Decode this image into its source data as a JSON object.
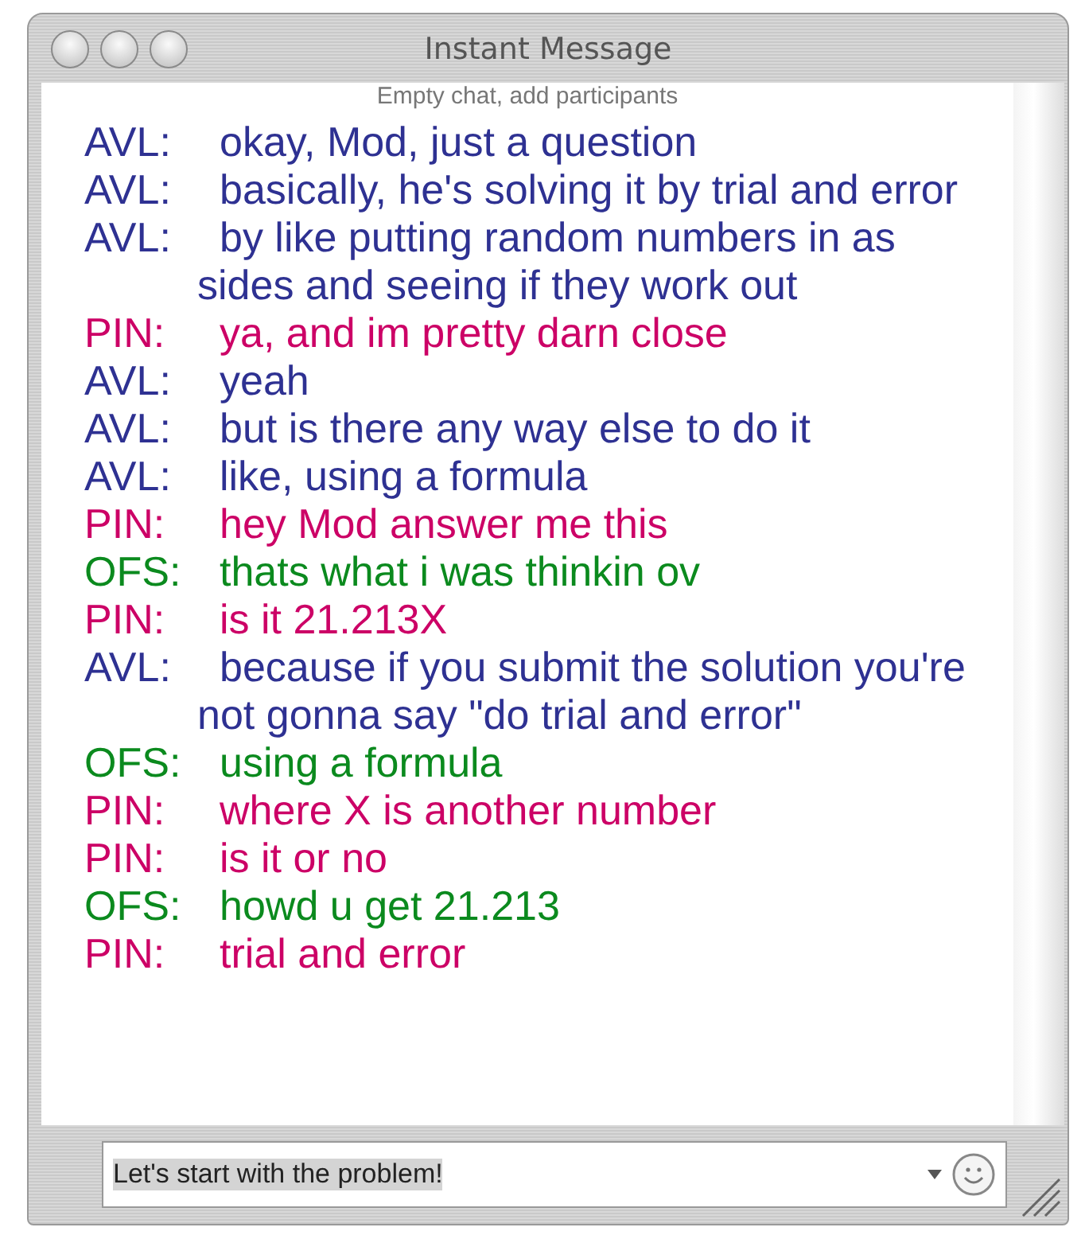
{
  "window": {
    "title": "Instant Message"
  },
  "chat": {
    "status": "Empty chat, add participants",
    "messages": [
      {
        "sender": "AVL:",
        "text": "okay, Mod, just a question",
        "color": "#2e3192"
      },
      {
        "sender": "AVL:",
        "text": "basically, he's solving it by trial and error",
        "color": "#2e3192"
      },
      {
        "sender": "AVL:",
        "text": "by like putting random numbers in as sides and seeing if they work out",
        "color": "#2e3192"
      },
      {
        "sender": "PIN:",
        "text": "ya, and im pretty darn close",
        "color": "#cc0066"
      },
      {
        "sender": "AVL:",
        "text": "yeah",
        "color": "#2e3192"
      },
      {
        "sender": "AVL:",
        "text": "but is there any way else to do it",
        "color": "#2e3192"
      },
      {
        "sender": "AVL:",
        "text": "like, using a formula",
        "color": "#2e3192"
      },
      {
        "sender": "PIN:",
        "text": "hey Mod answer me this",
        "color": "#cc0066"
      },
      {
        "sender": "OFS:",
        "text": "thats what i was thinkin ov",
        "color": "#0b8a1e"
      },
      {
        "sender": "PIN:",
        "text": "is it 21.213X",
        "color": "#cc0066"
      },
      {
        "sender": "AVL:",
        "text": "because if you submit the solution you're not gonna say \"do trial and error\"",
        "color": "#2e3192"
      },
      {
        "sender": "OFS:",
        "text": "using a formula",
        "color": "#0b8a1e"
      },
      {
        "sender": "PIN:",
        "text": "where X is another number",
        "color": "#cc0066"
      },
      {
        "sender": "PIN:",
        "text": "is it or no",
        "color": "#cc0066"
      },
      {
        "sender": "OFS:",
        "text": "howd u get 21.213",
        "color": "#0b8a1e"
      },
      {
        "sender": "PIN:",
        "text": "trial and error",
        "color": "#cc0066"
      }
    ]
  },
  "input": {
    "value": "Let's start with the problem!"
  }
}
